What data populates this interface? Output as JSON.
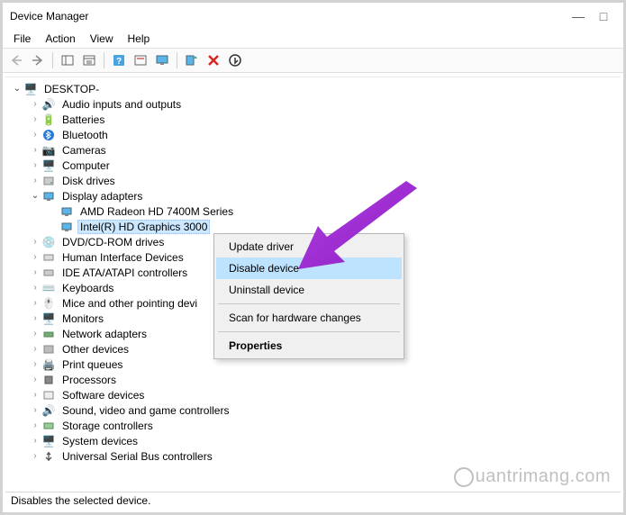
{
  "window": {
    "title": "Device Manager",
    "minimize": "—",
    "maximize": "□"
  },
  "menu": {
    "file": "File",
    "action": "Action",
    "view": "View",
    "help": "Help"
  },
  "tree": {
    "root": "DESKTOP-",
    "items": [
      "Audio inputs and outputs",
      "Batteries",
      "Bluetooth",
      "Cameras",
      "Computer",
      "Disk drives",
      "Display adapters",
      "DVD/CD-ROM drives",
      "Human Interface Devices",
      "IDE ATA/ATAPI controllers",
      "Keyboards",
      "Mice and other pointing devi",
      "Monitors",
      "Network adapters",
      "Other devices",
      "Print queues",
      "Processors",
      "Software devices",
      "Sound, video and game controllers",
      "Storage controllers",
      "System devices",
      "Universal Serial Bus controllers"
    ],
    "display_children": [
      "AMD Radeon HD 7400M Series",
      "Intel(R) HD Graphics 3000"
    ]
  },
  "context_menu": {
    "update": "Update driver",
    "disable": "Disable device",
    "uninstall": "Uninstall device",
    "scan": "Scan for hardware changes",
    "properties": "Properties"
  },
  "status": "Disables the selected device.",
  "watermark": "uantrimang.com"
}
